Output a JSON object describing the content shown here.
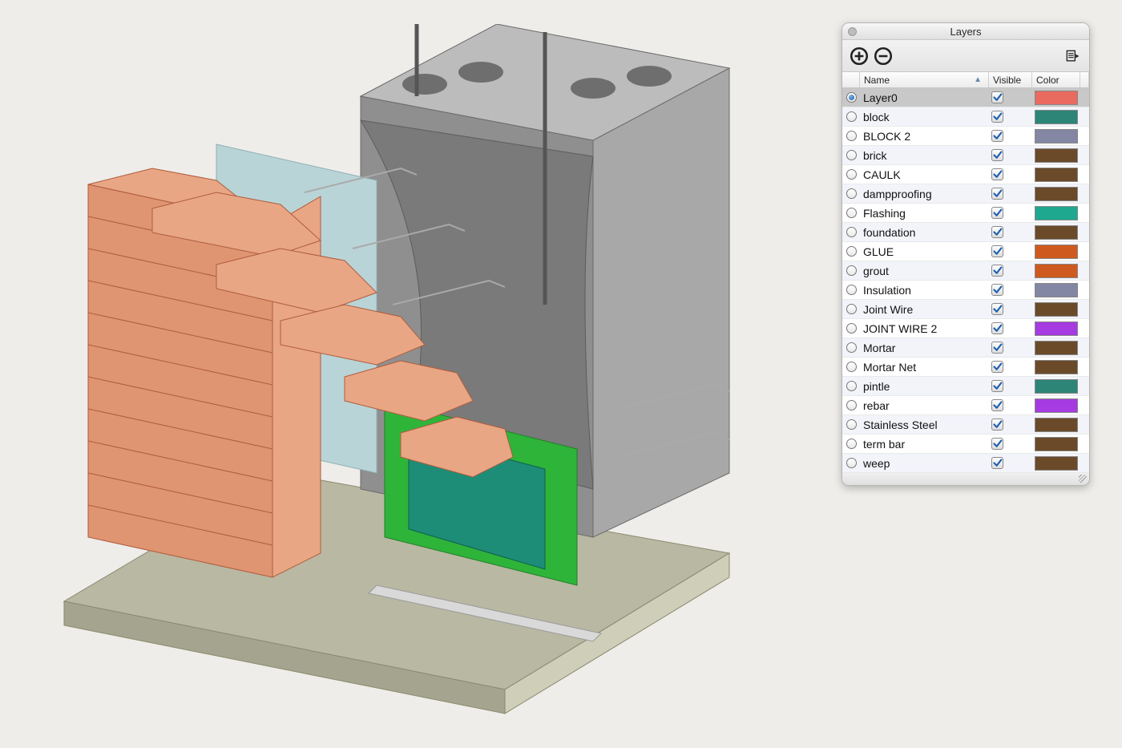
{
  "panel": {
    "title": "Layers",
    "columns": {
      "name": "Name",
      "visible": "Visible",
      "color": "Color"
    }
  },
  "layers": [
    {
      "name": "Layer0",
      "visible": true,
      "color": "#e96a5f",
      "active": true
    },
    {
      "name": "block",
      "visible": true,
      "color": "#2d8577",
      "active": false
    },
    {
      "name": "BLOCK 2",
      "visible": true,
      "color": "#8487a3",
      "active": false
    },
    {
      "name": "brick",
      "visible": true,
      "color": "#6b4a2a",
      "active": false
    },
    {
      "name": "CAULK",
      "visible": true,
      "color": "#6b4a2a",
      "active": false
    },
    {
      "name": "dampproofing",
      "visible": true,
      "color": "#6b4a2a",
      "active": false
    },
    {
      "name": "Flashing",
      "visible": true,
      "color": "#1fa890",
      "active": false
    },
    {
      "name": "foundation",
      "visible": true,
      "color": "#6b4a2a",
      "active": false
    },
    {
      "name": "GLUE",
      "visible": true,
      "color": "#cf5a1f",
      "active": false
    },
    {
      "name": "grout",
      "visible": true,
      "color": "#cf5a1f",
      "active": false
    },
    {
      "name": "Insulation",
      "visible": true,
      "color": "#8487a3",
      "active": false
    },
    {
      "name": "Joint Wire",
      "visible": true,
      "color": "#6b4a2a",
      "active": false
    },
    {
      "name": "JOINT WIRE 2",
      "visible": true,
      "color": "#a53be0",
      "active": false
    },
    {
      "name": "Mortar",
      "visible": true,
      "color": "#6b4a2a",
      "active": false
    },
    {
      "name": "Mortar Net",
      "visible": true,
      "color": "#6b4a2a",
      "active": false
    },
    {
      "name": "pintle",
      "visible": true,
      "color": "#2d8577",
      "active": false
    },
    {
      "name": "rebar",
      "visible": true,
      "color": "#a53be0",
      "active": false
    },
    {
      "name": "Stainless Steel",
      "visible": true,
      "color": "#6b4a2a",
      "active": false
    },
    {
      "name": "term bar",
      "visible": true,
      "color": "#6b4a2a",
      "active": false
    },
    {
      "name": "weep",
      "visible": true,
      "color": "#6b4a2a",
      "active": false
    }
  ]
}
